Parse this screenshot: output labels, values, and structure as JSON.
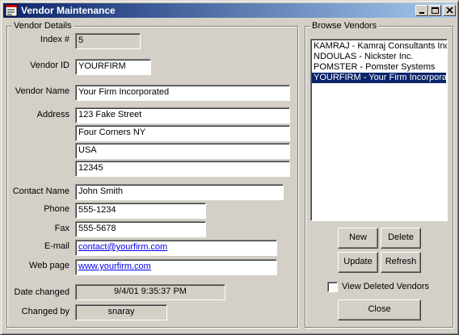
{
  "window": {
    "title": "Vendor Maintenance"
  },
  "details": {
    "legend": "Vendor Details",
    "index_label": "Index #",
    "index_value": "5",
    "vendor_id_label": "Vendor ID",
    "vendor_id_value": "YOURFIRM",
    "vendor_name_label": "Vendor Name",
    "vendor_name_value": "Your Firm Incorporated",
    "address_label": "Address",
    "address_lines": [
      "123 Fake Street",
      "Four Corners NY",
      "USA",
      "12345"
    ],
    "contact_label": "Contact Name",
    "contact_value": "John Smith",
    "phone_label": "Phone",
    "phone_value": "555-1234",
    "fax_label": "Fax",
    "fax_value": "555-5678",
    "email_label": "E-mail",
    "email_value": "contact@yourfirm.com",
    "web_label": "Web page",
    "web_value": "www.yourfirm.com",
    "date_changed_label": "Date changed",
    "date_changed_value": "9/4/01 9:35:37 PM",
    "changed_by_label": "Changed by",
    "changed_by_value": "snaray"
  },
  "browse": {
    "legend": "Browse Vendors",
    "items": [
      "KAMRAJ - Kamraj Consultants Inc.",
      "NDOULAS - Nickster Inc.",
      "POMSTER - Pomster Systems",
      "YOURFIRM - Your Firm Incorporat"
    ],
    "selected_index": 3,
    "new_label": "New",
    "delete_label": "Delete",
    "update_label": "Update",
    "refresh_label": "Refresh",
    "view_deleted_label": "View Deleted Vendors",
    "view_deleted_checked": false,
    "close_label": "Close"
  },
  "colors": {
    "titlebar": "#0a246a",
    "face": "#d4d0c8",
    "selection": "#0a246a",
    "link": "#0000ee"
  }
}
